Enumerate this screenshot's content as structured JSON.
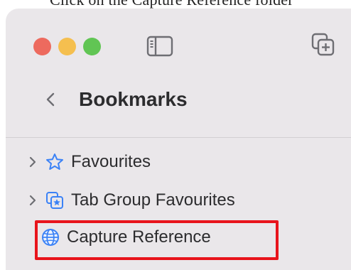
{
  "header_caption": "Click on the Capture Reference folder",
  "toolbar": {
    "traffic_lights": [
      "close",
      "minimize",
      "zoom"
    ],
    "sidebar_toggle_icon": "sidebar-icon",
    "new_tab_group_icon": "tab-group-add-icon"
  },
  "navigation": {
    "back_icon": "chevron-left-icon",
    "title": "Bookmarks"
  },
  "bookmarks": [
    {
      "label": "Favourites",
      "icon": "star-icon",
      "expandable": true
    },
    {
      "label": "Tab Group Favourites",
      "icon": "tab-group-star-icon",
      "expandable": true
    },
    {
      "label": "Capture Reference",
      "icon": "globe-icon",
      "expandable": false,
      "highlighted": true
    }
  ],
  "colors": {
    "sidebar_bg": "#eae7ea",
    "accent_blue": "#3b82f6",
    "highlight": "#e8141c",
    "close": "#ed6a5e",
    "minimize": "#f5bf4f",
    "zoom": "#61c554"
  }
}
